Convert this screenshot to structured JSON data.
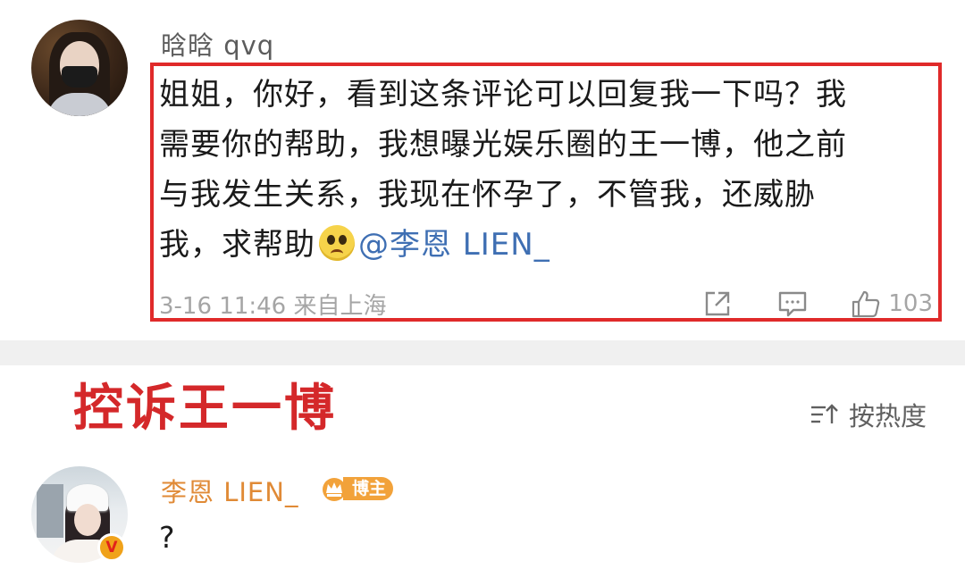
{
  "comment": {
    "username": "晗晗 qvq",
    "lines": [
      "姐姐，你好，看到这条评论可以回复我一下吗？我",
      "需要你的帮助，我想曝光娱乐圈的王一博，他之前",
      "与我发生关系，我现在怀孕了，不管我，还威胁",
      "我，求帮助"
    ],
    "mention": "@李恩 LIEN_",
    "timestamp": "3-16 11:46 来自上海",
    "like_count": "103",
    "highlight_color": "#e02a2a"
  },
  "overlay": {
    "title": "控诉王一博",
    "color": "#d4282a"
  },
  "sort": {
    "label": "按热度",
    "icon": "sort-icon"
  },
  "reply": {
    "username": "李恩 LIEN_",
    "username_color": "#e08a36",
    "badge_label": "博主",
    "verified_mark": "V",
    "text": "?"
  },
  "icons": {
    "share": "share-icon",
    "comment": "comment-icon",
    "like": "thumbs-up-icon",
    "emoji": "pleading-face-emoji"
  },
  "colors": {
    "link": "#3f6fb3",
    "meta": "#a5a5a5",
    "badge": "#f2a23a"
  }
}
